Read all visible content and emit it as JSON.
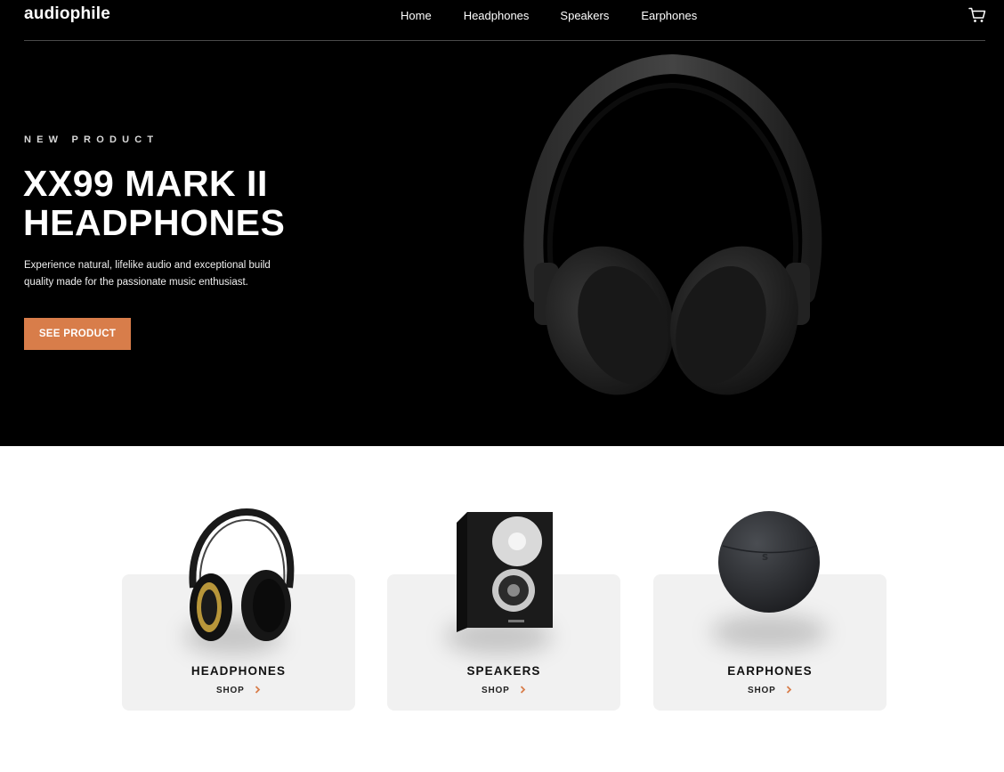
{
  "brand": {
    "logo": "audiophile"
  },
  "nav": {
    "items": [
      {
        "label": "Home"
      },
      {
        "label": "Headphones"
      },
      {
        "label": "Speakers"
      },
      {
        "label": "Earphones"
      }
    ]
  },
  "hero": {
    "eyebrow": "NEW PRODUCT",
    "title": "XX99 MARK II HEADPHONES",
    "description": "Experience natural, lifelike audio and exceptional build quality made for the passionate music enthusiast.",
    "cta": "SEE PRODUCT"
  },
  "categories": [
    {
      "title": "HEADPHONES",
      "link": "SHOP"
    },
    {
      "title": "SPEAKERS",
      "link": "SHOP"
    },
    {
      "title": "EARPHONES",
      "link": "SHOP"
    }
  ],
  "colors": {
    "accent": "#d87d4a",
    "hero_bg": "#000000",
    "card_bg": "#f1f1f1"
  },
  "icons": {
    "cart": "cart-icon",
    "chevron": "chevron-right-icon"
  }
}
